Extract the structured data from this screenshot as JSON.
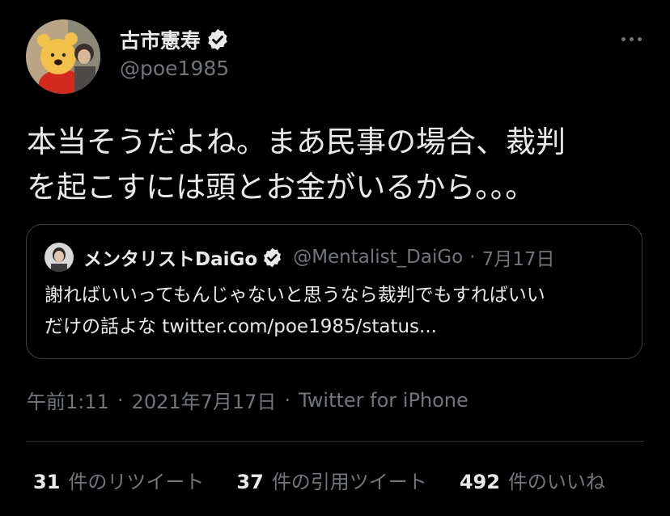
{
  "author": {
    "display_name": "古市憲寿",
    "handle": "@poe1985",
    "verified": true
  },
  "tweet": {
    "text_lines": [
      "本当そうだよね。まあ民事の場合、裁判",
      "を起こすには頭とお金がいるから。。。"
    ]
  },
  "quote": {
    "display_name": "メンタリストDaiGo",
    "handle": "@Mentalist_DaiGo",
    "separator": "·",
    "date": "7月17日",
    "text_lines": [
      "謝ればいいってもんじゃないと思うなら裁判でもすればいい",
      "だけの話よな twitter.com/poe1985/status..."
    ]
  },
  "meta": {
    "time": "午前1:11",
    "separator": "·",
    "date": "2021年7月17日",
    "source": "Twitter for iPhone"
  },
  "stats": [
    {
      "count": "31",
      "label": "件のリツイート"
    },
    {
      "count": "37",
      "label": "件の引用ツイート"
    },
    {
      "count": "492",
      "label": "件のいいね"
    }
  ],
  "icons": {
    "verified": "verified-badge-icon",
    "more": "more-options-icon"
  },
  "colors": {
    "background": "#000000",
    "primary_text": "#e7e9ea",
    "secondary_text": "#71767b",
    "border": "#3a3d41"
  }
}
